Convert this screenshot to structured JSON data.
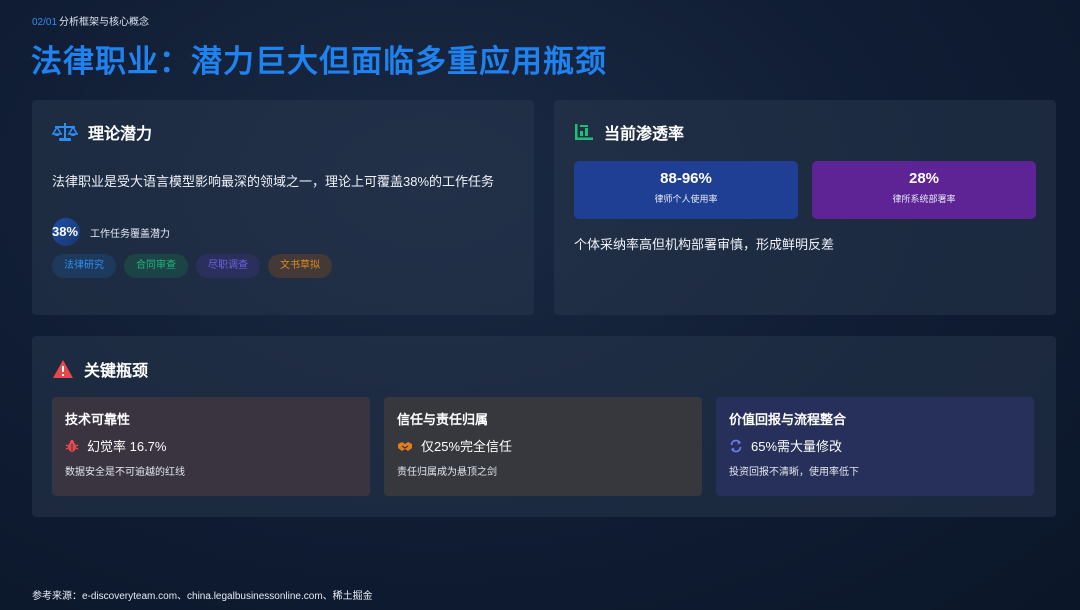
{
  "header": {
    "section_num": "02/01",
    "section_title": "分析框架与核心概念",
    "title": "法律职业：潜力巨大但面临多重应用瓶颈"
  },
  "potential": {
    "title": "理论潜力",
    "icon": "scale-icon",
    "text": "法律职业是受大语言模型影响最深的领域之一，理论上可覆盖38%的工作任务",
    "stat_value": "38%",
    "stat_label": "工作任务覆盖潜力",
    "tags": [
      "法律研究",
      "合同审查",
      "尽职调查",
      "文书草拟"
    ]
  },
  "penetration": {
    "title": "当前渗透率",
    "icon": "bar-chart-icon",
    "metrics": [
      {
        "value": "88-96%",
        "label": "律师个人使用率"
      },
      {
        "value": "28%",
        "label": "律所系统部署率"
      }
    ],
    "note": "个体采纳率高但机构部署审慎，形成鲜明反差"
  },
  "bottleneck": {
    "title": "关键瓶颈",
    "icon": "warning-icon",
    "items": [
      {
        "title": "技术可靠性",
        "stat": "幻觉率 16.7%",
        "desc": "数据安全是不可逾越的红线"
      },
      {
        "title": "信任与责任归属",
        "stat": "仅25%完全信任",
        "desc": "责任归属成为悬顶之剑"
      },
      {
        "title": "价值回报与流程整合",
        "stat": "65%需大量修改",
        "desc": "投资回报不清晰，使用率低下"
      }
    ]
  },
  "footer": {
    "sources": "参考来源：e-discoveryteam.com、china.legalbusinessonline.com、稀土掘金"
  },
  "colors": {
    "accent": "#1e82f0",
    "metric_blue": "#1f3f95",
    "metric_purple": "#5e2394",
    "warning": "#e5484d"
  }
}
